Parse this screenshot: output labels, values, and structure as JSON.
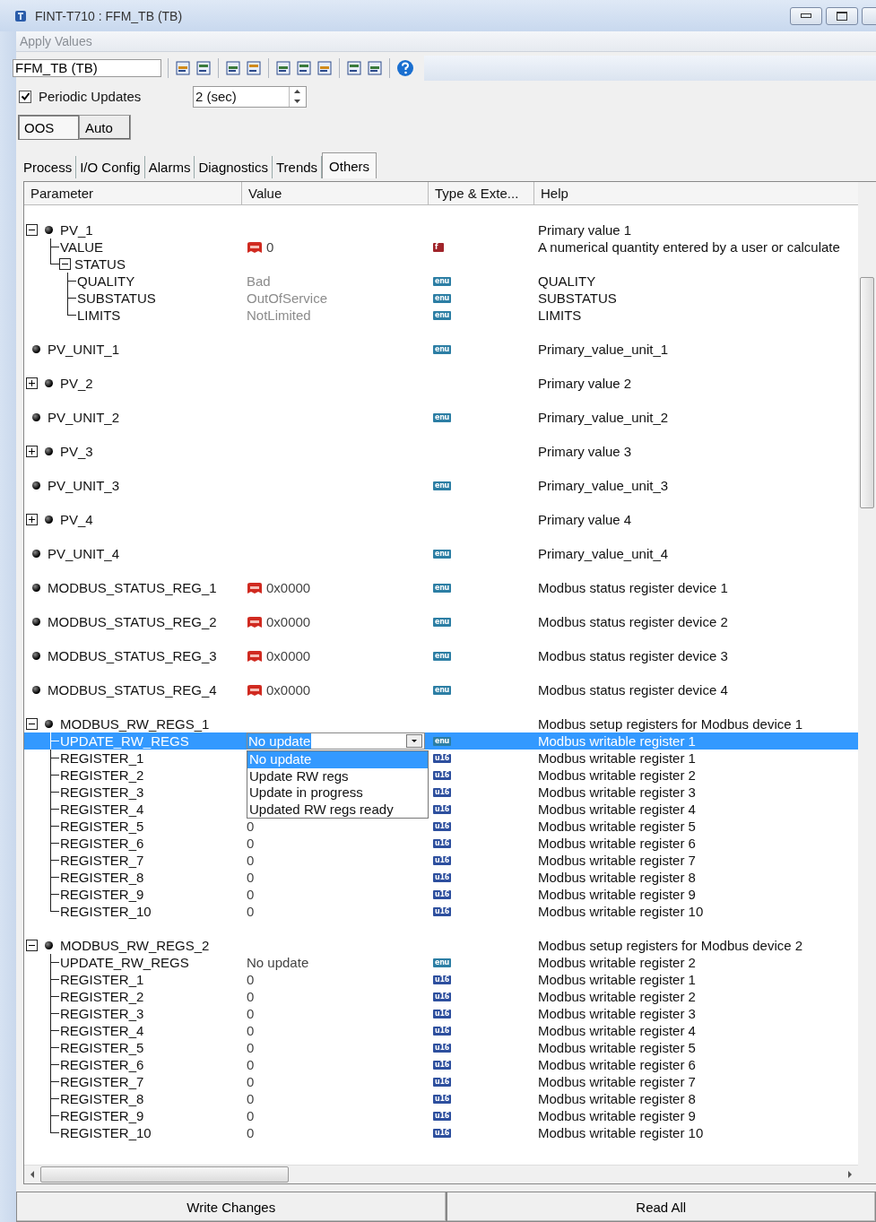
{
  "window": {
    "title": "FINT-T710 : FFM_TB (TB)"
  },
  "menu": [
    {
      "label": "Apply Values",
      "disabled": true
    }
  ],
  "block_field": {
    "value": "FFM_TB (TB)"
  },
  "periodic_updates": {
    "label": "Periodic Updates",
    "checked": true,
    "interval": "2 (sec)"
  },
  "modes": [
    {
      "label": "OOS",
      "selected": true
    },
    {
      "label": "Auto",
      "selected": false
    }
  ],
  "tabs": [
    {
      "label": "Process",
      "selected": false
    },
    {
      "label": "I/O Config",
      "selected": false
    },
    {
      "label": "Alarms",
      "selected": false
    },
    {
      "label": "Diagnostics",
      "selected": false
    },
    {
      "label": "Trends",
      "selected": false
    },
    {
      "label": "Others",
      "selected": true
    }
  ],
  "table": {
    "columns": [
      "Parameter",
      "Value",
      "Type & Exte...",
      "Help"
    ],
    "parameters": [
      {
        "name": "PV_1",
        "expanded": true,
        "selected": false,
        "help": "Primary value 1",
        "children": [
          {
            "name": "VALUE",
            "selected": false,
            "dynamic": true,
            "value": "0",
            "type": "f",
            "help": "A numerical quantity entered by a user or calculate"
          },
          {
            "name": "STATUS",
            "expanded": true,
            "selected": false,
            "children": [
              {
                "name": "QUALITY",
                "selected": false,
                "disabled": true,
                "value": "Bad",
                "type": "enu",
                "help": "QUALITY"
              },
              {
                "name": "SUBSTATUS",
                "selected": false,
                "disabled": true,
                "value": "OutOfService",
                "type": "enu",
                "help": "SUBSTATUS"
              },
              {
                "name": "LIMITS",
                "selected": false,
                "disabled": true,
                "value": "NotLimited",
                "type": "enu",
                "help": "LIMITS"
              }
            ]
          }
        ]
      },
      {
        "name": "PV_UNIT_1",
        "selected": false,
        "type": "enu",
        "help": "Primary_value_unit_1"
      },
      {
        "name": "PV_2",
        "expanded": false,
        "selected": false,
        "help": "Primary value 2"
      },
      {
        "name": "PV_UNIT_2",
        "selected": false,
        "type": "enu",
        "help": "Primary_value_unit_2"
      },
      {
        "name": "PV_3",
        "expanded": false,
        "selected": false,
        "help": "Primary value 3"
      },
      {
        "name": "PV_UNIT_3",
        "selected": false,
        "type": "enu",
        "help": "Primary_value_unit_3"
      },
      {
        "name": "PV_4",
        "expanded": false,
        "selected": false,
        "help": "Primary value 4"
      },
      {
        "name": "PV_UNIT_4",
        "selected": false,
        "type": "enu",
        "help": "Primary_value_unit_4"
      },
      {
        "name": "MODBUS_STATUS_REG_1",
        "selected": false,
        "dynamic": true,
        "value": "0x0000",
        "type": "enu",
        "help": "Modbus status register device 1"
      },
      {
        "name": "MODBUS_STATUS_REG_2",
        "selected": false,
        "dynamic": true,
        "value": "0x0000",
        "type": "enu",
        "help": "Modbus status register device 2"
      },
      {
        "name": "MODBUS_STATUS_REG_3",
        "selected": false,
        "dynamic": true,
        "value": "0x0000",
        "type": "enu",
        "help": "Modbus status register device 3"
      },
      {
        "name": "MODBUS_STATUS_REG_4",
        "selected": false,
        "dynamic": true,
        "value": "0x0000",
        "type": "enu",
        "help": "Modbus status register device 4"
      },
      {
        "name": "MODBUS_RW_REGS_1",
        "expanded": true,
        "selected": false,
        "help": "Modbus setup registers for Modbus device 1",
        "children": [
          {
            "name": "UPDATE_RW_REGS",
            "selected": true,
            "value": "No update",
            "type": "enu",
            "help": "Modbus writable register 1",
            "dropdown": {
              "open": true,
              "options": [
                {
                  "label": "No update",
                  "selected": true
                },
                {
                  "label": "Update RW regs",
                  "selected": false
                },
                {
                  "label": "Update in progress",
                  "selected": false
                },
                {
                  "label": "Updated RW regs ready",
                  "selected": false
                }
              ]
            }
          },
          {
            "name": "REGISTER_1",
            "selected": false,
            "type": "u16",
            "help": "Modbus writable register 1"
          },
          {
            "name": "REGISTER_2",
            "selected": false,
            "type": "u16",
            "help": "Modbus writable register 2"
          },
          {
            "name": "REGISTER_3",
            "selected": false,
            "type": "u16",
            "help": "Modbus writable register 3"
          },
          {
            "name": "REGISTER_4",
            "selected": false,
            "type": "u16",
            "help": "Modbus writable register 4"
          },
          {
            "name": "REGISTER_5",
            "selected": false,
            "value": "0",
            "type": "u16",
            "help": "Modbus writable register 5"
          },
          {
            "name": "REGISTER_6",
            "selected": false,
            "value": "0",
            "type": "u16",
            "help": "Modbus writable register 6"
          },
          {
            "name": "REGISTER_7",
            "selected": false,
            "value": "0",
            "type": "u16",
            "help": "Modbus writable register 7"
          },
          {
            "name": "REGISTER_8",
            "selected": false,
            "value": "0",
            "type": "u16",
            "help": "Modbus writable register 8"
          },
          {
            "name": "REGISTER_9",
            "selected": false,
            "value": "0",
            "type": "u16",
            "help": "Modbus writable register 9"
          },
          {
            "name": "REGISTER_10",
            "selected": false,
            "value": "0",
            "type": "u16",
            "help": "Modbus writable register 10"
          }
        ]
      },
      {
        "name": "MODBUS_RW_REGS_2",
        "expanded": true,
        "selected": false,
        "help": "Modbus setup registers for Modbus device 2",
        "children": [
          {
            "name": "UPDATE_RW_REGS",
            "selected": false,
            "value": "No update",
            "type": "enu",
            "help": "Modbus writable register 2"
          },
          {
            "name": "REGISTER_1",
            "selected": false,
            "value": "0",
            "type": "u16",
            "help": "Modbus writable register 1"
          },
          {
            "name": "REGISTER_2",
            "selected": false,
            "value": "0",
            "type": "u16",
            "help": "Modbus writable register 2"
          },
          {
            "name": "REGISTER_3",
            "selected": false,
            "value": "0",
            "type": "u16",
            "help": "Modbus writable register 3"
          },
          {
            "name": "REGISTER_4",
            "selected": false,
            "value": "0",
            "type": "u16",
            "help": "Modbus writable register 4"
          },
          {
            "name": "REGISTER_5",
            "selected": false,
            "value": "0",
            "type": "u16",
            "help": "Modbus writable register 5"
          },
          {
            "name": "REGISTER_6",
            "selected": false,
            "value": "0",
            "type": "u16",
            "help": "Modbus writable register 6"
          },
          {
            "name": "REGISTER_7",
            "selected": false,
            "value": "0",
            "type": "u16",
            "help": "Modbus writable register 7"
          },
          {
            "name": "REGISTER_8",
            "selected": false,
            "value": "0",
            "type": "u16",
            "help": "Modbus writable register 8"
          },
          {
            "name": "REGISTER_9",
            "selected": false,
            "value": "0",
            "type": "u16",
            "help": "Modbus writable register 9"
          },
          {
            "name": "REGISTER_10",
            "selected": false,
            "value": "0",
            "type": "u16",
            "help": "Modbus writable register 10"
          }
        ]
      }
    ]
  },
  "buttons": [
    "Write Changes",
    "Read All"
  ]
}
